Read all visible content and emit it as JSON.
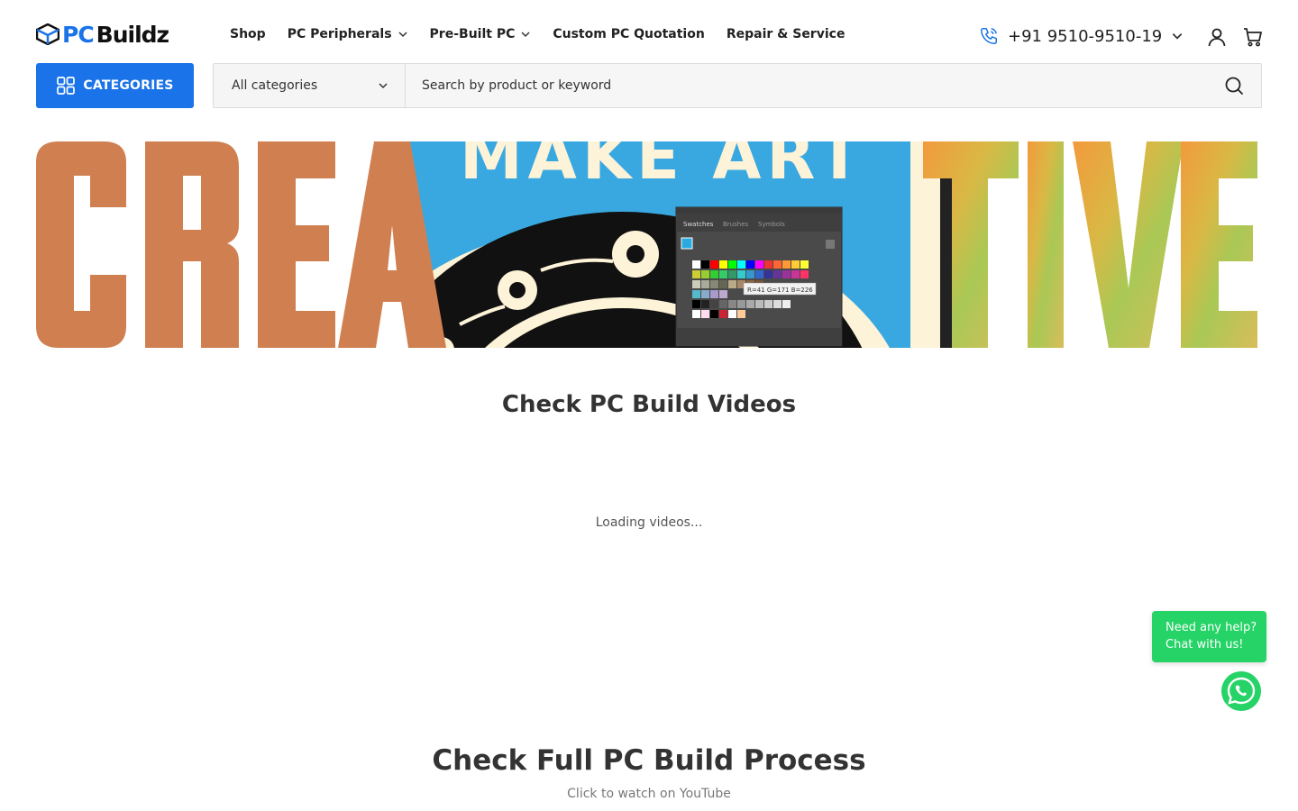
{
  "header": {
    "logo": {
      "part1": "PC",
      "part2": "Buildz"
    },
    "nav": [
      {
        "label": "Shop",
        "dropdown": false
      },
      {
        "label": "PC Peripherals",
        "dropdown": true
      },
      {
        "label": "Pre-Built PC",
        "dropdown": true
      },
      {
        "label": "Custom PC Quotation",
        "dropdown": false
      },
      {
        "label": "Repair & Service",
        "dropdown": false
      }
    ],
    "phone": "+91 9510-9510-19",
    "icons": [
      "phone-icon",
      "user-icon",
      "cart-icon"
    ]
  },
  "search": {
    "categories_button": "CATEGORIES",
    "category_select": "All categories",
    "placeholder": "Search by product or keyword"
  },
  "banner": {
    "words": [
      "CREA",
      "MAKE ART",
      "TIVE"
    ],
    "panel": {
      "tabs": [
        "Swatches",
        "Brushes",
        "Symbols"
      ],
      "tooltip": "R=41 G=171 B=226"
    }
  },
  "videos": {
    "title": "Check PC Build Videos",
    "loading": "Loading videos..."
  },
  "process": {
    "title": "Check Full PC Build Process",
    "subtitle": "Click to watch on YouTube"
  },
  "chat": {
    "line1": "Need any help?",
    "line2": "Chat with us!"
  },
  "colors": {
    "brand_blue": "#1a73e8",
    "whatsapp_green": "#25d366",
    "banner_orange": "#d07f50",
    "banner_sky": "#3aa8e0"
  }
}
